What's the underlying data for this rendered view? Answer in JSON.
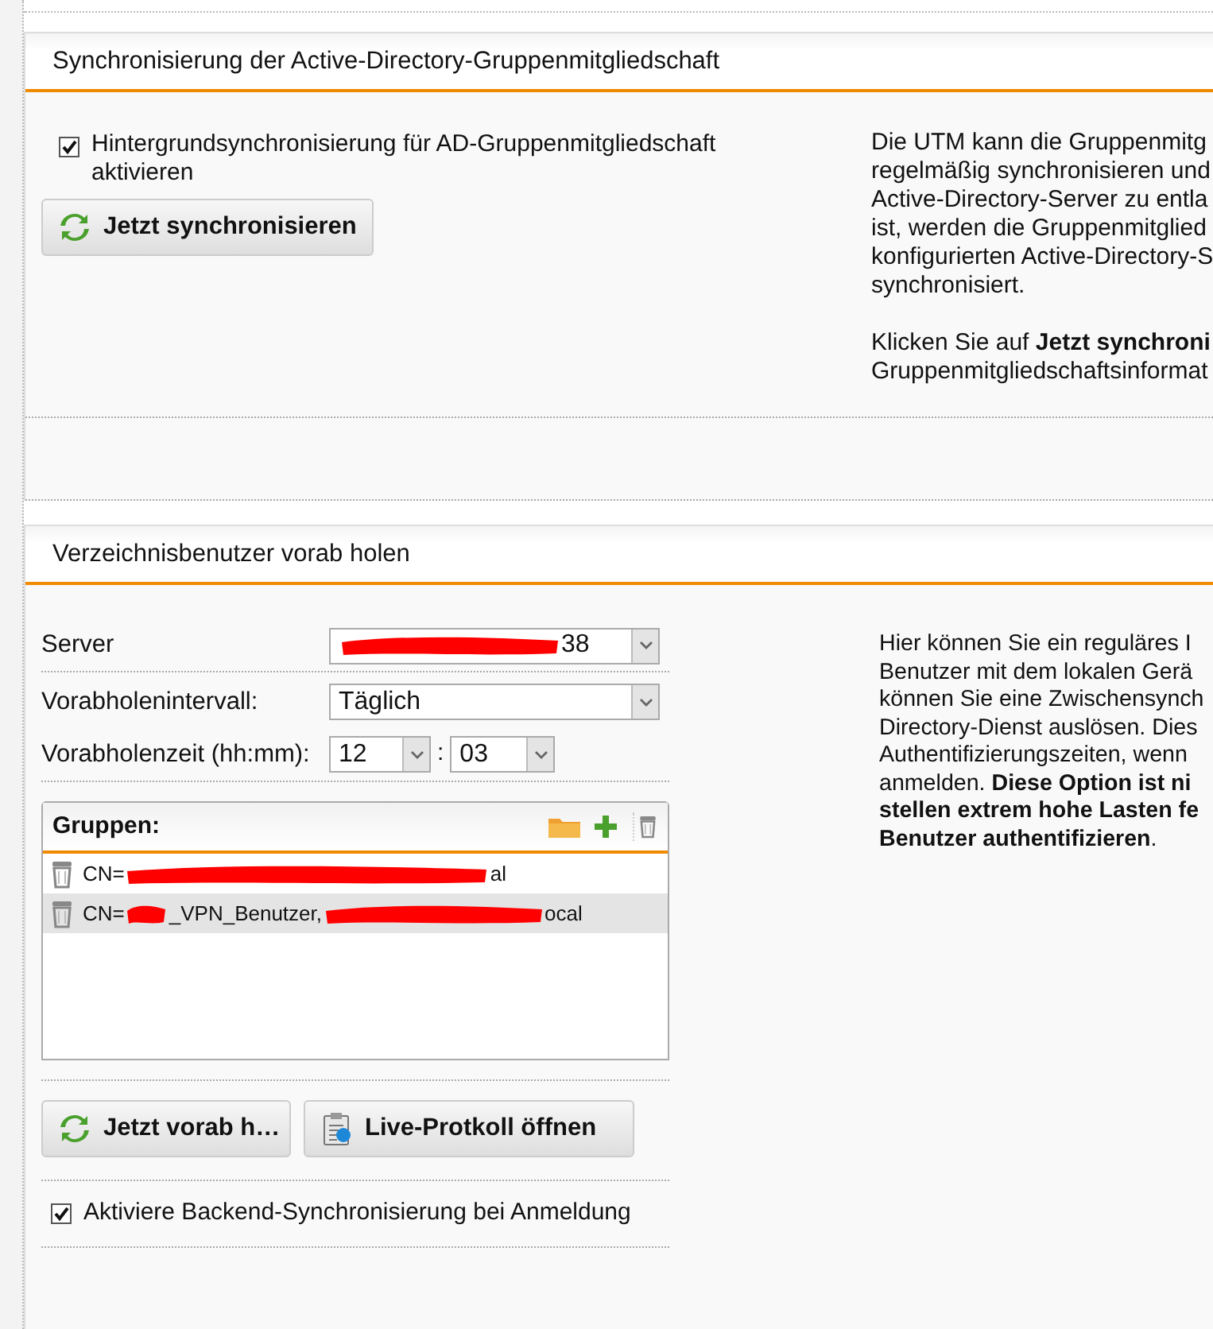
{
  "ad_sync": {
    "title": "Synchronisierung der Active-Directory-Gruppenmitgliedschaft",
    "checkbox": {
      "label": "Hintergrundsynchronisierung für AD-Gruppenmitgliedschaft aktivieren",
      "checked": true
    },
    "button": {
      "label": "Jetzt synchronisieren"
    },
    "help": [
      [
        "Die UTM kann die Gruppenmitg",
        "regelmäßig synchronisieren und",
        "Active-Directory-Server zu entla",
        "ist, werden die Gruppenmitglied",
        "konfigurierten Active-Directory-S",
        "synchronisiert."
      ],
      [
        "Klicken Sie auf **Jetzt synchroni**",
        "Gruppenmitgliedschaftsinformat"
      ]
    ]
  },
  "prefetch": {
    "title": "Verzeichnisbenutzer vorab holen",
    "server": {
      "label": "Server",
      "value_end": "38"
    },
    "interval": {
      "label": "Vorabholenintervall:",
      "value": "Täglich"
    },
    "time": {
      "label": "Vorabholenzeit (hh:mm):",
      "hour": "12",
      "separator": ":",
      "minute": "03"
    },
    "groups": {
      "title": "Gruppen:",
      "rows": [
        {
          "selected": false,
          "parts": [
            {
              "kind": "text",
              "text": "CN="
            },
            {
              "kind": "redacted"
            },
            {
              "kind": "text",
              "text": "al"
            }
          ]
        },
        {
          "selected": true,
          "parts": [
            {
              "kind": "text",
              "text": "CN="
            },
            {
              "kind": "redacted"
            },
            {
              "kind": "text",
              "text": "_VPN_Benutzer,"
            },
            {
              "kind": "redacted"
            },
            {
              "kind": "text",
              "text": "ocal"
            }
          ]
        }
      ]
    },
    "buttons": [
      {
        "label": "Jetzt vorab h…"
      },
      {
        "label": "Live-Protkoll öffnen"
      }
    ],
    "checkbox": {
      "label": "Aktiviere Backend-Synchronisierung bei Anmeldung",
      "checked": true
    },
    "help": [
      [
        "Hier können Sie ein reguläres I",
        "Benutzer mit dem lokalen Gerä",
        "können Sie eine Zwischensynch",
        "Directory-Dienst auslösen. Dies",
        "Authentifizierungszeiten, wenn",
        "anmelden. **Diese Option ist ni**",
        "**stellen extrem hohe Lasten fe**",
        "**Benutzer authentifizieren**."
      ]
    ]
  }
}
